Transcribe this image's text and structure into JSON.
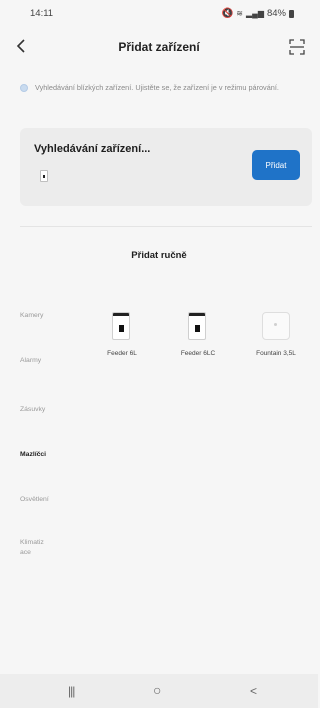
{
  "status": {
    "time": "14:11",
    "battery": "84%"
  },
  "header": {
    "title": "Přidat zařízení",
    "back_icon": "chevron-left-icon",
    "scan_icon": "scan-frame-icon"
  },
  "info": {
    "text": "Vyhledávání blízkých zařízení. Ujistěte se, že zařízení je v režimu párování."
  },
  "search_card": {
    "title": "Vyhledávání zařízení...",
    "add_label": "Přidat",
    "button_color": "#1f73c8"
  },
  "manual": {
    "title": "Přidat ručně"
  },
  "categories": [
    {
      "label": "Kamery"
    },
    {
      "label": "Alarmy"
    },
    {
      "label": "Zásuvky"
    },
    {
      "label": "Mazlíčci",
      "active": true
    },
    {
      "label": "Osvětlení"
    },
    {
      "label": "Klimatizace"
    }
  ],
  "products": [
    {
      "name": "Feeder 6L",
      "icon": "pet-feeder-icon"
    },
    {
      "name": "Feeder 6LC",
      "icon": "pet-feeder-icon"
    },
    {
      "name": "Fountain 3,5L",
      "icon": "pet-fountain-icon"
    }
  ],
  "nav": {
    "recent": "|||",
    "home": "○",
    "back": "<"
  }
}
